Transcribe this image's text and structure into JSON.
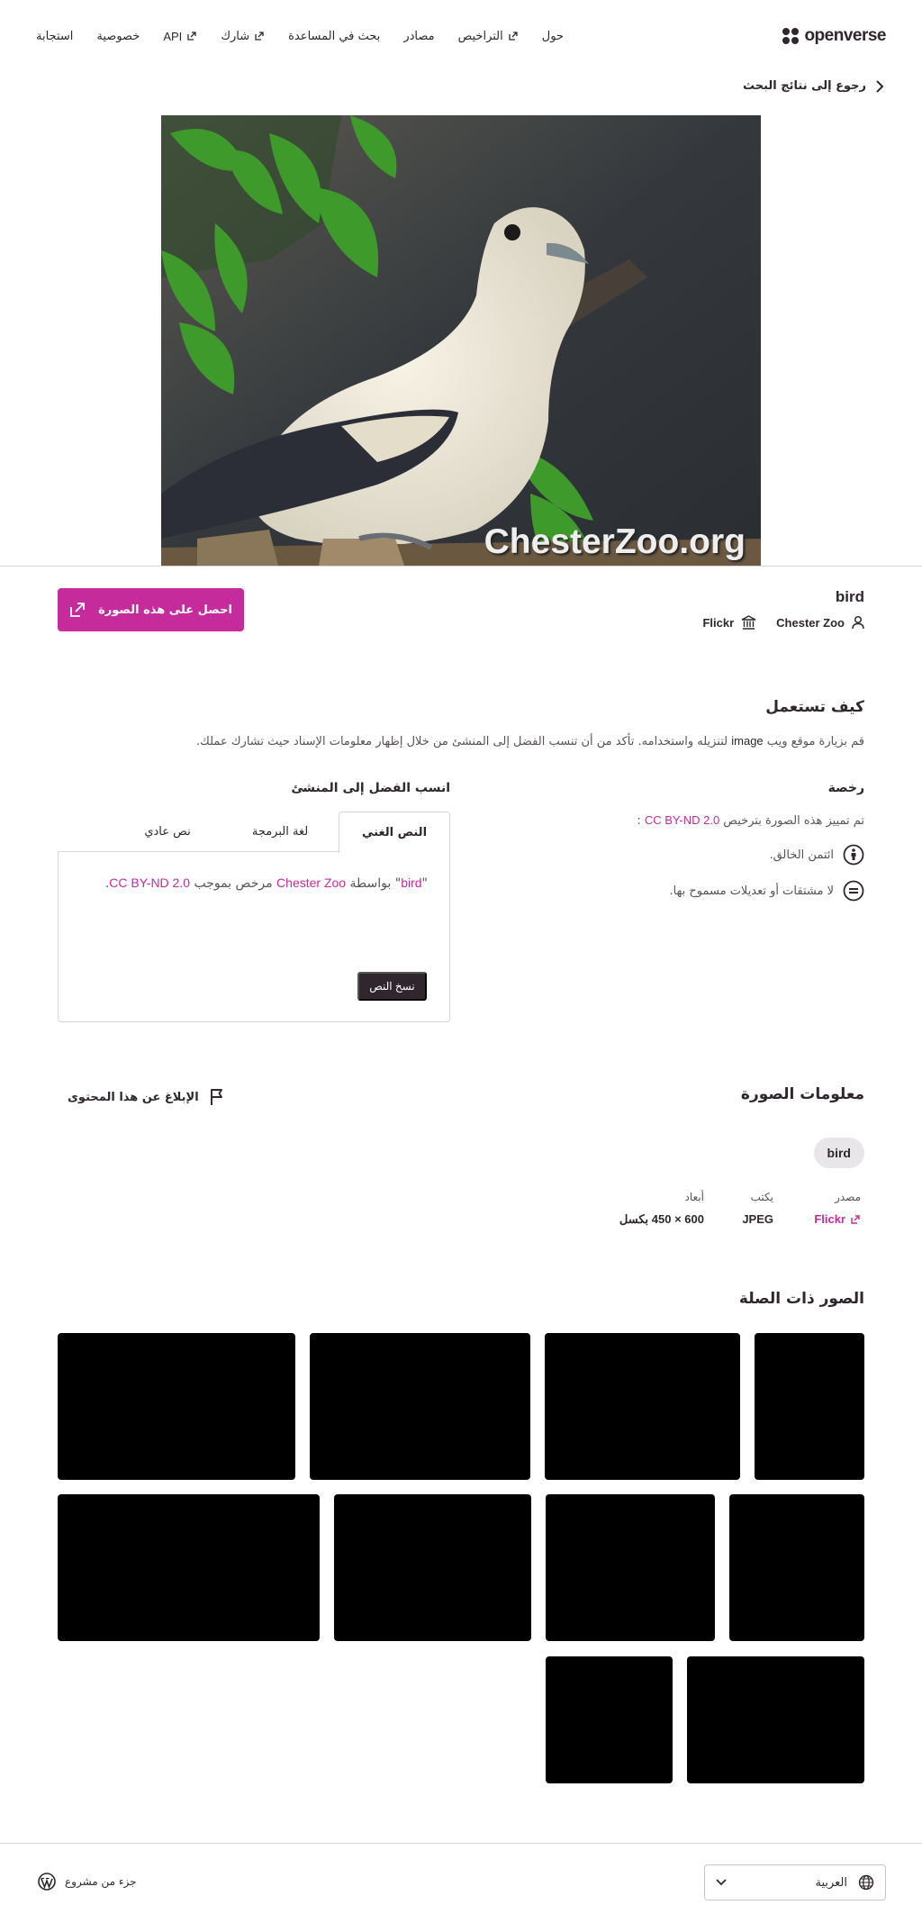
{
  "header": {
    "logo_text": "openverse",
    "nav": [
      {
        "label": "حول",
        "external": false
      },
      {
        "label": "التراخيص",
        "external": true
      },
      {
        "label": "مصادر",
        "external": false
      },
      {
        "label": "بحث في المساعدة",
        "external": false
      },
      {
        "label": "شارك",
        "external": true
      },
      {
        "label": "API",
        "external": true
      },
      {
        "label": "خصوصية",
        "external": false
      },
      {
        "label": "استجابة",
        "external": false
      }
    ]
  },
  "back_link": "رجوع إلى نتائج البحث",
  "main_image": {
    "watermark": "ChesterZoo.org"
  },
  "image": {
    "title": "bird",
    "creator": "Chester Zoo",
    "source": "Flickr",
    "get_button": "احصل على هذه الصورة"
  },
  "how_to_use": {
    "title": "كيف تستعمل",
    "desc_prefix": "قم بزيارة موقع ويب ",
    "desc_link": "image",
    "desc_suffix": " لتنزيله واستخدامه. تأكد من أن تنسب الفضل إلى المنشئ من خلال إظهار معلومات الإسناد حيث تشارك عملك."
  },
  "license": {
    "title": "رخصة",
    "line_prefix": "تم تمييز هذه الصورة بترخيص ",
    "license_name": "CC BY-ND 2.0",
    "line_suffix": " :",
    "items": [
      {
        "icon": "by-icon",
        "text": "ائتمن الخالق."
      },
      {
        "icon": "nd-icon",
        "text": "لا مشتقات أو تعديلات مسموح بها."
      }
    ]
  },
  "attribution": {
    "title": "انسب الفضل إلى المنشئ",
    "tabs": [
      "النص الغني",
      "لغة البرمجة",
      "نص عادي"
    ],
    "active_tab": 0,
    "quote_open": "\"",
    "title_link": "bird",
    "quote_close": "\"",
    "by_text": " بواسطة ",
    "creator_link": "Chester Zoo",
    "licensed_text": " مرخص بموجب ",
    "license_link": "CC BY-ND 2.0",
    "end": ".",
    "copy_button": "نسخ النص"
  },
  "image_info": {
    "title": "معلومات الصورة",
    "report": "الإبلاغ عن هذا المحتوى",
    "tag": "bird",
    "fields": [
      {
        "label": "مصدر",
        "value": "Flickr"
      },
      {
        "label": "يكتب",
        "value": "JPEG"
      },
      {
        "label": "أبعاد",
        "value": "600 × 450 بكسل"
      }
    ]
  },
  "related": {
    "title": "الصور ذات الصلة"
  },
  "footer": {
    "language": "العربية",
    "part_of": "جزء من مشروع"
  },
  "colors": {
    "accent": "#c52b9b",
    "text": "#30272e",
    "dark_button": "#30272e"
  }
}
